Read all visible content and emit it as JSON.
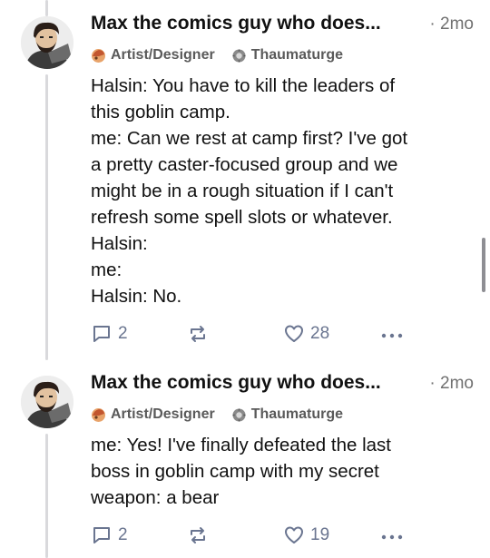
{
  "posts": [
    {
      "author": "Max the comics guy who does...",
      "time": "· 2mo",
      "badges": [
        {
          "label": "Artist/Designer",
          "icon": "palette-icon"
        },
        {
          "label": "Thaumaturge",
          "icon": "gear-icon"
        }
      ],
      "lines": [
        "Halsin: You have to kill the leaders of",
        "this goblin camp.",
        "me: Can we rest at camp first? I've got",
        "a pretty caster-focused group and we",
        "might be in a rough situation if I can't",
        "refresh some spell slots or whatever.",
        "Halsin:",
        "me:",
        "Halsin: No."
      ],
      "replies": "2",
      "reposts": "",
      "likes": "28"
    },
    {
      "author": "Max the comics guy who does...",
      "time": "· 2mo",
      "badges": [
        {
          "label": "Artist/Designer",
          "icon": "palette-icon"
        },
        {
          "label": "Thaumaturge",
          "icon": "gear-icon"
        }
      ],
      "lines": [
        "me: Yes! I've finally defeated the last",
        "boss in goblin camp with my secret",
        "weapon: a bear"
      ],
      "replies": "2",
      "reposts": "",
      "likes": "19"
    }
  ],
  "colors": {
    "accent_icon": "#6a7590",
    "thread_line": "#d9d9dc",
    "meta_text": "#707070"
  }
}
